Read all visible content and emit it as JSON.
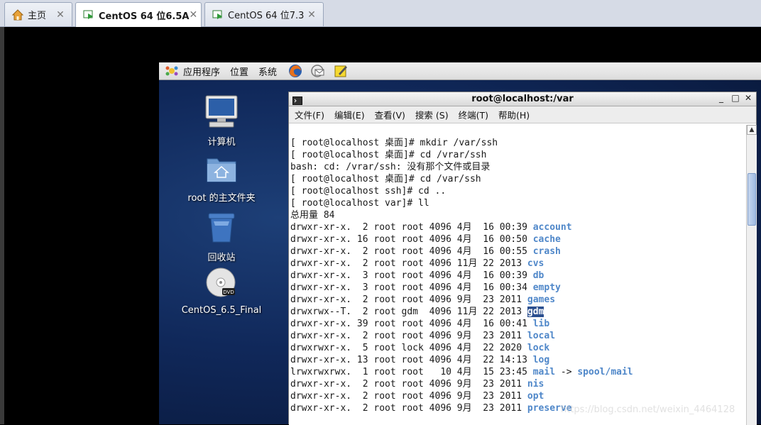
{
  "tabs": [
    {
      "label": "主页",
      "icon": "home-icon",
      "close": "✕"
    },
    {
      "label": "CentOS 64 位6.5A",
      "icon": "vm-play-icon",
      "close": "✕"
    },
    {
      "label": "CentOS 64 位7.3",
      "icon": "vm-play-icon",
      "close": "✕"
    }
  ],
  "panel": {
    "menus": [
      "应用程序",
      "位置",
      "系统"
    ],
    "launchers": [
      "firefox-icon",
      "mail-icon",
      "notes-icon"
    ]
  },
  "desktop": {
    "icons": [
      {
        "label": "计算机",
        "icon": "computer-icon"
      },
      {
        "label": "root 的主文件夹",
        "icon": "home-folder-icon"
      },
      {
        "label": "回收站",
        "icon": "trash-icon"
      },
      {
        "label": "CentOS_6.5_Final",
        "icon": "dvd-icon"
      }
    ]
  },
  "terminal": {
    "title": "root@localhost:/var",
    "window_buttons": [
      "_",
      "□",
      "✕"
    ],
    "menu": [
      "文件(F)",
      "编辑(E)",
      "查看(V)",
      "搜索 (S)",
      "终端(T)",
      "帮助(H)"
    ],
    "lines": [
      {
        "text": "[ root@localhost 桌面]# mkdir /var/ssh"
      },
      {
        "text": "[ root@localhost 桌面]# cd /vrar/ssh"
      },
      {
        "text": "bash: cd: /vrar/ssh: 没有那个文件或目录"
      },
      {
        "text": "[ root@localhost 桌面]# cd /var/ssh"
      },
      {
        "text": "[ root@localhost ssh]# cd .."
      },
      {
        "text": "[ root@localhost var]# ll"
      },
      {
        "text": "总用量 84"
      },
      {
        "text": "drwxr-xr-x.  2 root root 4096 4月  16 00:39 ",
        "name": "account"
      },
      {
        "text": "drwxr-xr-x. 16 root root 4096 4月  16 00:50 ",
        "name": "cache"
      },
      {
        "text": "drwxr-xr-x.  2 root root 4096 4月  16 00:55 ",
        "name": "crash"
      },
      {
        "text": "drwxr-xr-x.  2 root root 4096 11月 22 2013 ",
        "name": "cvs"
      },
      {
        "text": "drwxr-xr-x.  3 root root 4096 4月  16 00:39 ",
        "name": "db"
      },
      {
        "text": "drwxr-xr-x.  3 root root 4096 4月  16 00:34 ",
        "name": "empty"
      },
      {
        "text": "drwxr-xr-x.  2 root root 4096 9月  23 2011 ",
        "name": "games"
      },
      {
        "text": "drwxrwx--T.  2 root gdm  4096 11月 22 2013 ",
        "name": "gdm",
        "highlight": true
      },
      {
        "text": "drwxr-xr-x. 39 root root 4096 4月  16 00:41 ",
        "name": "lib"
      },
      {
        "text": "drwxr-xr-x.  2 root root 4096 9月  23 2011 ",
        "name": "local"
      },
      {
        "text": "drwxrwxr-x.  5 root lock 4096 4月  22 2020 ",
        "name": "lock"
      },
      {
        "text": "drwxr-xr-x. 13 root root 4096 4月  22 14:13 ",
        "name": "log"
      },
      {
        "text": "lrwxrwxrwx.  1 root root   10 4月  15 23:45 ",
        "name": "mail",
        "suffix": " -> ",
        "target": "spool/mail"
      },
      {
        "text": "drwxr-xr-x.  2 root root 4096 9月  23 2011 ",
        "name": "nis"
      },
      {
        "text": "drwxr-xr-x.  2 root root 4096 9月  23 2011 ",
        "name": "opt"
      },
      {
        "text": "drwxr-xr-x.  2 root root 4096 9月  23 2011 ",
        "name": "preserve"
      }
    ]
  },
  "watermark": "https://blog.csdn.net/weixin_4464128"
}
